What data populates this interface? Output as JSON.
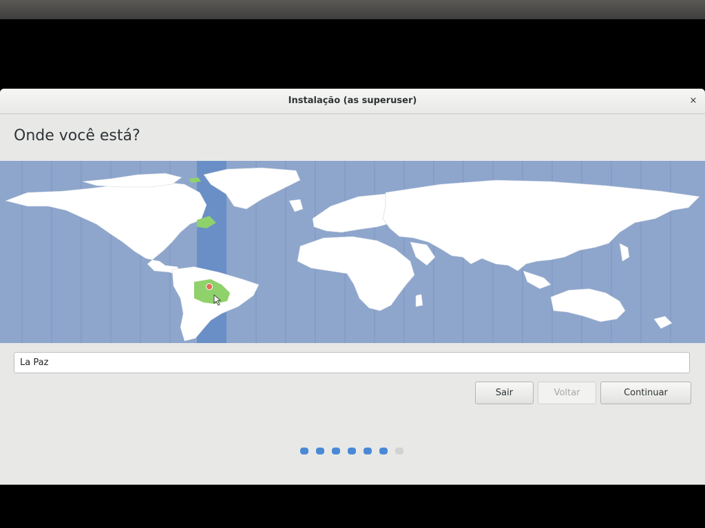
{
  "window": {
    "title": "Instalação (as superuser)",
    "close_glyph": "×"
  },
  "page": {
    "heading": "Onde você está?"
  },
  "map": {
    "selected_city": "La Paz",
    "colors": {
      "ocean": "#8ea6cc",
      "land": "#ffffff",
      "highlight_zone": "#6a8fc6",
      "selected_region": "#8fd16b",
      "marker": "#e86b55"
    }
  },
  "location_field": {
    "value": "La Paz"
  },
  "buttons": {
    "quit": "Sair",
    "back": "Voltar",
    "continue": "Continuar"
  },
  "progress": {
    "total_steps": 7,
    "completed_steps": 6
  },
  "colors": {
    "accent": "#4a89d6"
  }
}
